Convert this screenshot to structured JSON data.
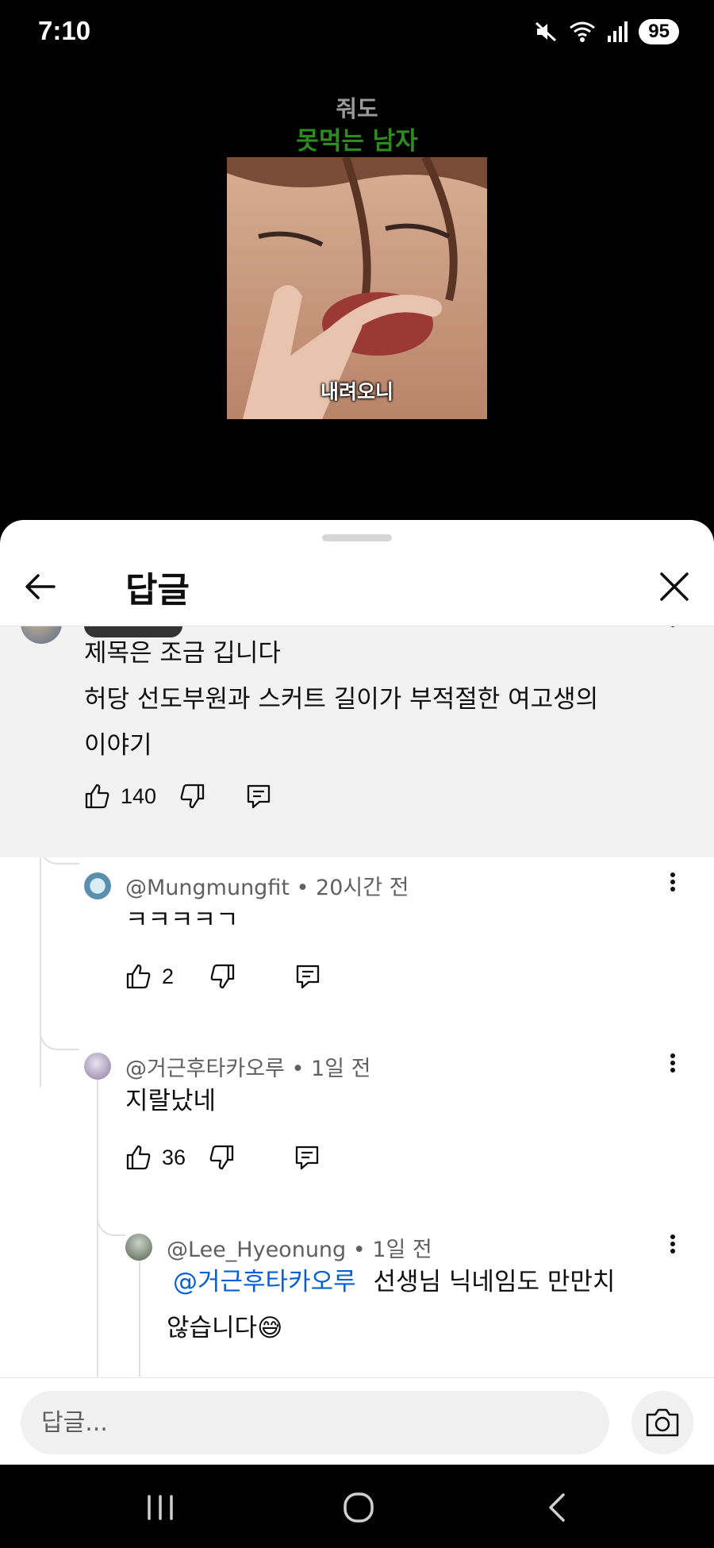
{
  "status_bar": {
    "time": "7:10",
    "battery": "95",
    "icons": [
      "mute-icon",
      "wifi-icon",
      "signal-icon",
      "battery-icon"
    ]
  },
  "video": {
    "title_line1": "줘도",
    "title_line2": "못먹는 남자",
    "caption": "내려오니",
    "colors": {
      "title_line2": "#2f8a1f",
      "title_line1": "#9a9a9a"
    }
  },
  "sheet": {
    "title": "답글",
    "back_icon": "arrow-left-icon",
    "close_icon": "close-icon"
  },
  "parent_comment": {
    "lines": [
      "제목은 조금 깁니다",
      "허당 선도부원과 스커트 길이가 부적절한 여고생의",
      "이야기"
    ],
    "likes": "140"
  },
  "replies": [
    {
      "handle": "@Mungmungfit",
      "time": "20시간 전",
      "text": "ㅋㅋㅋㅋㄱ",
      "likes": "2"
    },
    {
      "handle": "@거근후타카오루",
      "time": "1일 전",
      "text": "지랄났네",
      "likes": "36"
    },
    {
      "handle": "@Lee_Hyeonung",
      "time": "1일 전",
      "mention": "@거근후타카오루",
      "text_line1": "선생님 닉네임도 만만치",
      "text_line2": "않습니다😅"
    }
  ],
  "separator": "•",
  "reply_input": {
    "placeholder": "답글..."
  },
  "colors": {
    "mention": "#065fd4",
    "highlight_bg": "#f2f2f2"
  }
}
